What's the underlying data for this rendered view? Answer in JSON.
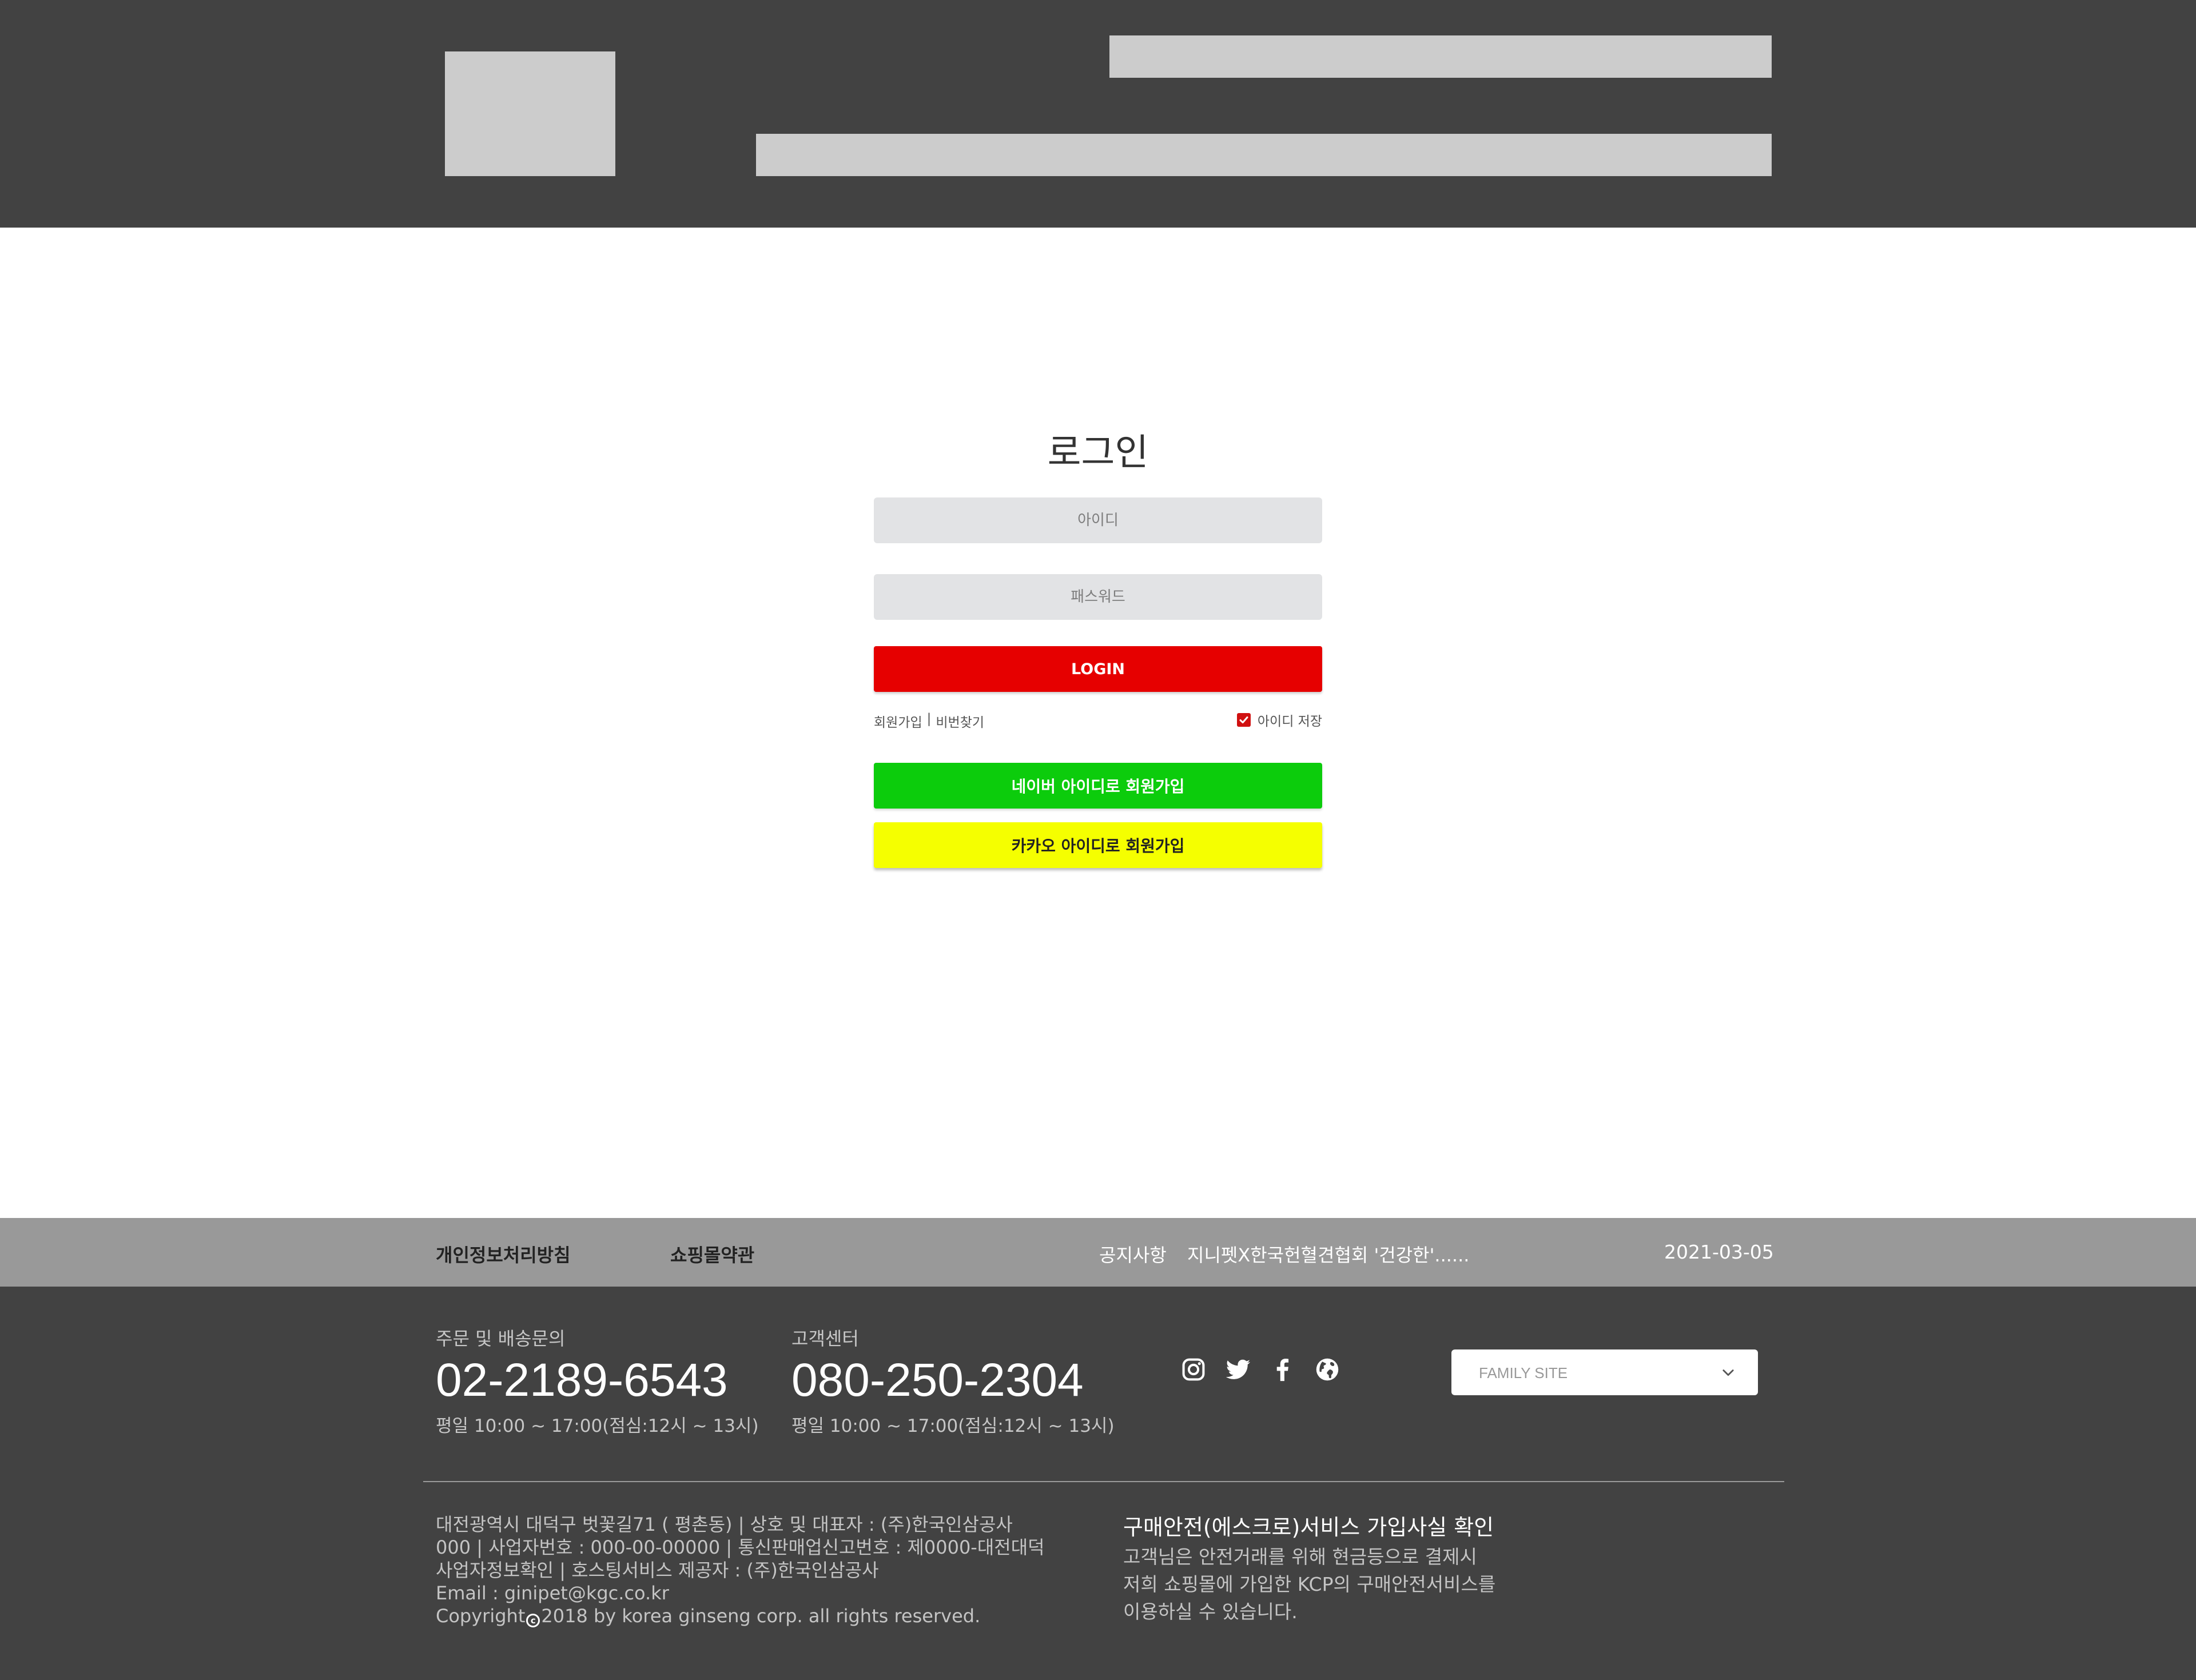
{
  "login": {
    "title": "로그인",
    "id_placeholder": "아이디",
    "password_placeholder": "패스워드",
    "login_button": "LOGIN",
    "signup_link": "회원가입",
    "separator": "|",
    "find_password_link": "비번찾기",
    "save_id_label": "아이디 저장",
    "save_id_checked": true,
    "naver_button": "네이버 아이디로 회원가입",
    "kakao_button": "카카오 아이디로 회원가입"
  },
  "footer_bar": {
    "privacy_link": "개인정보처리방침",
    "terms_link": "쇼핑몰약관",
    "notice_label": "공지사항",
    "notice_title": "지니펫X한국헌혈견협회 '건강한'......",
    "notice_date": "2021-03-05"
  },
  "footer": {
    "order_label": "주문 및 배송문의",
    "order_phone": "02-2189-6543",
    "order_hours": "평일 10:00 ~ 17:00(점심:12시 ~ 13시)",
    "cs_label": "고객센터",
    "cs_phone": "080-250-2304",
    "cs_hours": "평일 10:00 ~ 17:00(점심:12시 ~ 13시)",
    "social_icons": [
      "instagram-icon",
      "twitter-icon",
      "facebook-icon",
      "globe-icon"
    ],
    "family_site_label": "FAMILY SITE",
    "company_lines": [
      "대전광역시 대덕구 벗꽃길71 ( 평촌동) | 상호 및 대표자 : (주)한국인삼공사",
      "000 | 사업자번호 : 000-00-00000 | 통신판매업신고번호 : 제0000-대전대덕",
      "사업자정보확인 | 호스팅서비스 제공자 : (주)한국인삼공사",
      "Email : ginipet@kgc.co.kr"
    ],
    "copyright_prefix": "Copyright",
    "copyright_suffix": "2018 by korea ginseng corp. all rights reserved.",
    "escrow_title": "구매안전(에스크로)서비스 가입사실 확인",
    "escrow_lines": [
      "고객님은 안전거래를 위해 현금등으로 결제시",
      "저희 쇼핑몰에 가입한 KCP의 구매안전서비스를",
      "이용하실 수 있습니다."
    ]
  },
  "colors": {
    "header_bg": "#424242",
    "placeholder_block": "#cccccc",
    "login_red": "#e60000",
    "naver_green": "#0ccc0c",
    "kakao_yellow": "#f5ff00",
    "footer_bar_bg": "#999999",
    "footer_bg": "#424242"
  }
}
